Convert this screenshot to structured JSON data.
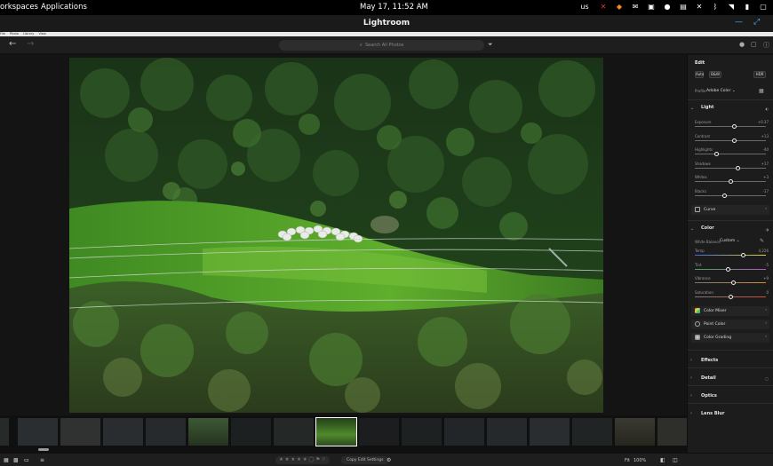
{
  "topbar": {
    "workspaces": "orkspaces",
    "applications": "Applications",
    "datetime": "May 17, 11:52 AM",
    "keyboard": "us"
  },
  "window": {
    "title": "Lightroom"
  },
  "menu": {
    "items": [
      "File",
      "Photo",
      "Library",
      "View"
    ]
  },
  "toolbar": {
    "search_placeholder": "Search All Photos"
  },
  "panel": {
    "heading": "Edit",
    "auto_label": "Auto",
    "bw_label": "B&W",
    "hdr_label": "HDR",
    "profile_label": "Profile",
    "profile_value": "Adobe Color",
    "light": {
      "title": "Light",
      "sliders": [
        {
          "label": "Exposure",
          "value": "+0.37",
          "pos": 0.55
        },
        {
          "label": "Contrast",
          "value": "+13",
          "pos": 0.55
        },
        {
          "label": "Highlights",
          "value": "-40",
          "pos": 0.3
        },
        {
          "label": "Shadows",
          "value": "+17",
          "pos": 0.6
        },
        {
          "label": "Whites",
          "value": "+3",
          "pos": 0.51
        },
        {
          "label": "Blacks",
          "value": "-17",
          "pos": 0.42
        }
      ],
      "curve_label": "Curve"
    },
    "color": {
      "title": "Color",
      "wb_label": "White Balance",
      "wb_value": "Custom",
      "sliders": [
        {
          "label": "Temp",
          "value": "4,226",
          "pos": 0.68
        },
        {
          "label": "Tint",
          "value": "-5",
          "pos": 0.47
        },
        {
          "label": "Vibrance",
          "value": "+9",
          "pos": 0.54
        },
        {
          "label": "Saturation",
          "value": "0",
          "pos": 0.5
        }
      ],
      "rows": [
        "Color Mixer",
        "Point Color",
        "Color Grading"
      ]
    },
    "effects": "Effects",
    "detail": "Detail",
    "optics": "Optics",
    "lens_blur": "Lens Blur"
  },
  "bottom": {
    "stars": "★ ★ ★ ★ ★",
    "copy_edit": "Copy Edit Settings",
    "fit": "Fit",
    "zoom": "100%"
  },
  "colors": {
    "accent": "#49b6ff",
    "panel_bg": "#1c1c1c",
    "canvas_bg": "#141414"
  }
}
